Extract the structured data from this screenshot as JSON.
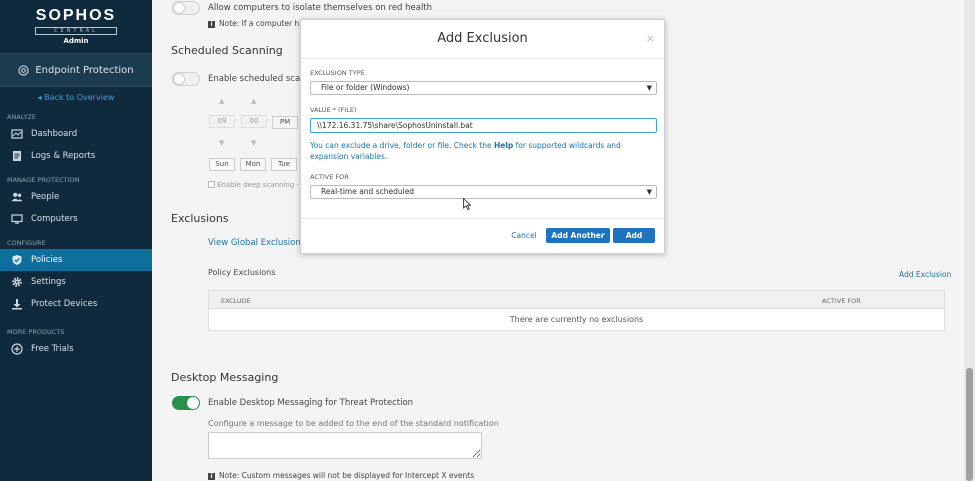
{
  "sidebar": {
    "brand": "SOPHOS",
    "brand_sub": "CENTRAL",
    "role": "Admin",
    "product": "Endpoint Protection",
    "back_link": "Back to Overview",
    "sections": {
      "analyze": "ANALYZE",
      "manage": "MANAGE PROTECTION",
      "configure": "CONFIGURE",
      "more": "MORE PRODUCTS"
    },
    "items": {
      "dashboard": "Dashboard",
      "logs": "Logs & Reports",
      "people": "People",
      "computers": "Computers",
      "policies": "Policies",
      "settings": "Settings",
      "protect": "Protect Devices",
      "trials": "Free Trials"
    }
  },
  "main": {
    "isolate_label": "Allow computers to isolate themselves on red health",
    "isolate_note": "Note: If a computer h",
    "scheduled_heading": "Scheduled Scanning",
    "scheduled_toggle_label": "Enable scheduled scan",
    "time_hour": "09",
    "time_min": "00",
    "time_ampm": "PM",
    "days": [
      "Sun",
      "Mon",
      "Tue"
    ],
    "deep_scan_label": "Enable deep scanning - s",
    "exclusions_heading": "Exclusions",
    "global_exclusions_link": "View Global Exclusions",
    "policy_exclusions_label": "Policy Exclusions",
    "add_exclusion_link": "Add Exclusion",
    "table": {
      "col_exclude": "EXCLUDE",
      "col_active": "ACTIVE FOR",
      "empty": "There are currently no exclusions"
    },
    "desktop_heading": "Desktop Messaging",
    "desktop_toggle_label": "Enable Desktop Messaging for Threat Protection",
    "desktop_hint": "Configure a message to be added to the end of the standard notification",
    "desktop_note": "Note: Custom messages will not be displayed for Intercept X events"
  },
  "modal": {
    "title": "Add Exclusion",
    "close": "×",
    "type_label": "EXCLUSION TYPE",
    "type_value": "File or folder (Windows)",
    "value_label": "VALUE * (FILE)",
    "value": "\\\\172.16.31.75\\share\\SophosUninstall.bat",
    "help_pre": "You can exclude a drive, folder or file. Check the ",
    "help_link": "Help",
    "help_post": " for supported wildcards and expansion variables.",
    "active_label": "ACTIVE FOR",
    "active_value": "Real-time and scheduled",
    "cancel": "Cancel",
    "add_another": "Add Another",
    "add": "Add"
  }
}
